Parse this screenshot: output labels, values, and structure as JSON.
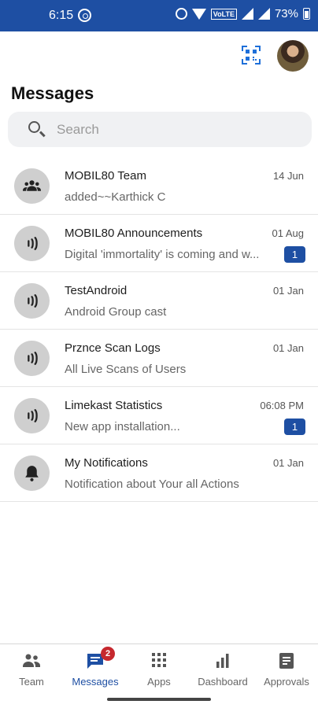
{
  "status_bar": {
    "time": "6:15",
    "volte": "VoLTE",
    "battery": "73%"
  },
  "header": {
    "title": "Messages"
  },
  "search": {
    "placeholder": "Search"
  },
  "conversations": [
    {
      "name": "MOBIL80 Team",
      "date": "14 Jun",
      "preview": " added~~Karthick C",
      "badge": "",
      "icon": "group-icon"
    },
    {
      "name": "MOBIL80 Announcements",
      "date": "01 Aug",
      "preview": "Digital 'immortality' is coming and w...",
      "badge": "1",
      "icon": "broadcast-icon"
    },
    {
      "name": "TestAndroid",
      "date": "01 Jan",
      "preview": "Android Group cast",
      "badge": "",
      "icon": "broadcast-icon"
    },
    {
      "name": "Prznce Scan Logs",
      "date": "01 Jan",
      "preview": "All Live Scans of Users",
      "badge": "",
      "icon": "broadcast-icon"
    },
    {
      "name": "Limekast Statistics",
      "date": "06:08 PM",
      "preview": "New app installation...",
      "badge": "1",
      "icon": "broadcast-icon"
    },
    {
      "name": "My Notifications",
      "date": "01 Jan",
      "preview": "Notification about Your all Actions",
      "badge": "",
      "icon": "bell-icon"
    }
  ],
  "bottom_nav": {
    "items": [
      {
        "label": "Team",
        "icon": "team-icon"
      },
      {
        "label": "Messages",
        "icon": "chat-icon",
        "badge": "2",
        "active": true
      },
      {
        "label": "Apps",
        "icon": "apps-grid-icon"
      },
      {
        "label": "Dashboard",
        "icon": "bar-chart-icon"
      },
      {
        "label": "Approvals",
        "icon": "document-icon"
      }
    ]
  },
  "colors": {
    "accent": "#1e4fa3",
    "badge_red": "#c6282e"
  }
}
